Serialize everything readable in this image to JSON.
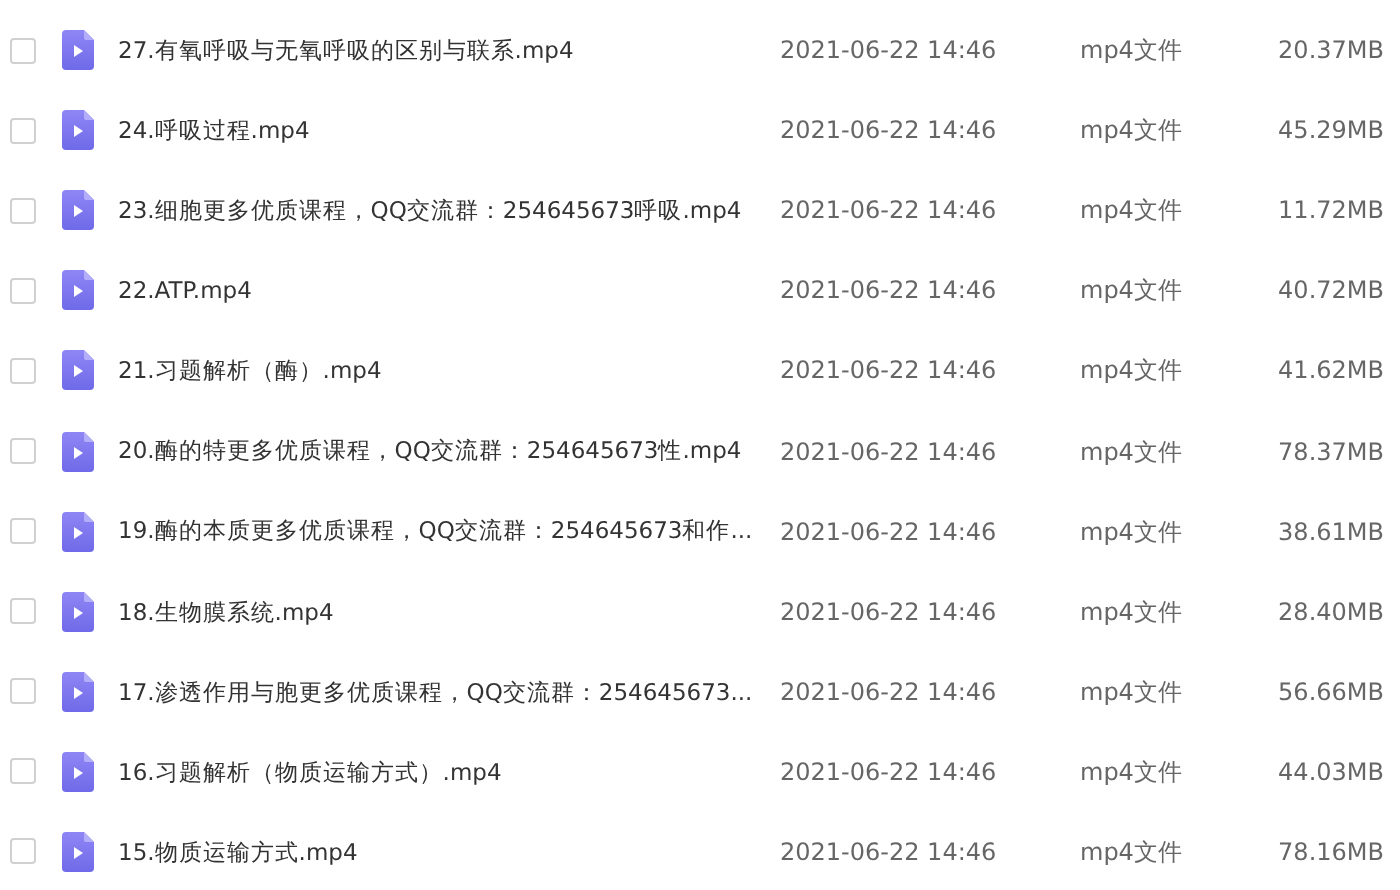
{
  "files": [
    {
      "name": "27.有氧呼吸与无氧呼吸的区别与联系.mp4",
      "checked": false,
      "modified": "2021-06-22 14:46",
      "type": "mp4文件",
      "size": "20.37MB"
    },
    {
      "name": "24.呼吸过程.mp4",
      "checked": false,
      "modified": "2021-06-22 14:46",
      "type": "mp4文件",
      "size": "45.29MB"
    },
    {
      "name": "23.细胞更多优质课程，QQ交流群：254645673呼吸.mp4",
      "checked": false,
      "modified": "2021-06-22 14:46",
      "type": "mp4文件",
      "size": "11.72MB"
    },
    {
      "name": "22.ATP.mp4",
      "checked": false,
      "modified": "2021-06-22 14:46",
      "type": "mp4文件",
      "size": "40.72MB"
    },
    {
      "name": "21.习题解析（酶）.mp4",
      "checked": false,
      "modified": "2021-06-22 14:46",
      "type": "mp4文件",
      "size": "41.62MB"
    },
    {
      "name": "20.酶的特更多优质课程，QQ交流群：254645673性.mp4",
      "checked": false,
      "modified": "2021-06-22 14:46",
      "type": "mp4文件",
      "size": "78.37MB"
    },
    {
      "name": "19.酶的本质更多优质课程，QQ交流群：254645673和作...",
      "checked": false,
      "modified": "2021-06-22 14:46",
      "type": "mp4文件",
      "size": "38.61MB"
    },
    {
      "name": "18.生物膜系统.mp4",
      "checked": false,
      "modified": "2021-06-22 14:46",
      "type": "mp4文件",
      "size": "28.40MB"
    },
    {
      "name": "17.渗透作用与胞更多优质课程，QQ交流群：254645673...",
      "checked": false,
      "modified": "2021-06-22 14:46",
      "type": "mp4文件",
      "size": "56.66MB"
    },
    {
      "name": "16.习题解析（物质运输方式）.mp4",
      "checked": false,
      "modified": "2021-06-22 14:46",
      "type": "mp4文件",
      "size": "44.03MB"
    },
    {
      "name": "15.物质运输方式.mp4",
      "checked": false,
      "modified": "2021-06-22 14:46",
      "type": "mp4文件",
      "size": "78.16MB"
    }
  ]
}
